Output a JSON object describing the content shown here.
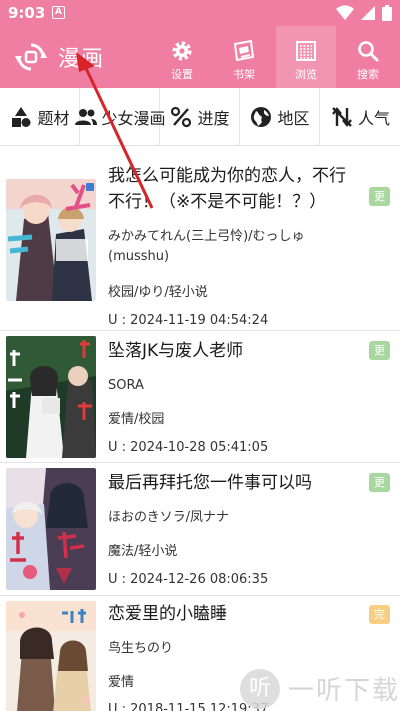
{
  "status_bar": {
    "time": "9:03",
    "notification_badge": "A",
    "icons": [
      "wifi-icon",
      "signal-icon",
      "battery-icon"
    ]
  },
  "app_bar": {
    "title": "漫画",
    "actions": [
      {
        "icon": "gear-icon",
        "label": "设置"
      },
      {
        "icon": "bookshelf-icon",
        "label": "书架"
      },
      {
        "icon": "browse-grid-icon",
        "label": "浏览",
        "active": true
      },
      {
        "icon": "search-icon",
        "label": "搜索"
      }
    ],
    "colors": {
      "primary": "#f07ea3"
    }
  },
  "filters": [
    {
      "icon": "shapes-icon",
      "label": "题材"
    },
    {
      "icon": "people-icon",
      "label": "少女漫画"
    },
    {
      "icon": "percent-icon",
      "label": "进度"
    },
    {
      "icon": "globe-icon",
      "label": "地区"
    },
    {
      "icon": "sort-icon",
      "label": "人气"
    }
  ],
  "manga": [
    {
      "title": "我怎么可能成为你的恋人，不行不行！（※不是不可能！？）",
      "author": "みかみてれん(三上弓怜)/むっしゅ(musshu)",
      "tags": "校园/ゆり/轻小说",
      "updated": "U : 2024-11-19 04:54:24",
      "badge": "更"
    },
    {
      "title": "坠落JK与废人老师",
      "author": "SORA",
      "tags": "爱情/校园",
      "updated": "U : 2024-10-28 05:41:05",
      "badge": "更"
    },
    {
      "title": "最后再拜托您一件事可以吗",
      "author": "ほおのきソラ/凤ナナ",
      "tags": "魔法/轻小说",
      "updated": "U : 2024-12-26 08:06:35",
      "badge": "更"
    },
    {
      "title": "恋爱里的小瞌睡",
      "author": "鸟生ちのり",
      "tags": "爱情",
      "updated": "U : 2018-11-15 12:19:37",
      "badge": "完"
    }
  ],
  "watermark": {
    "icon_char": "听",
    "text": "一听下载"
  }
}
